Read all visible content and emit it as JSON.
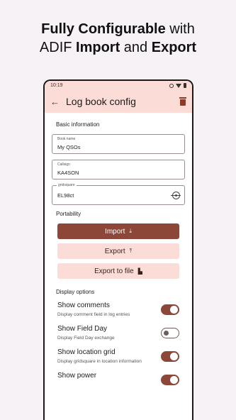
{
  "headline": {
    "line1_a": "Fully Configurable",
    "line1_b": " with",
    "line2_a": "ADIF ",
    "line2_b": "Import",
    "line2_c": " and ",
    "line2_d": "Export"
  },
  "statusbar": {
    "time": "10:19"
  },
  "appbar": {
    "title": "Log book config",
    "back_icon": "arrow-back-icon",
    "delete_icon": "trash-icon"
  },
  "basic": {
    "section_title": "Basic information",
    "book_name": {
      "label": "Book name",
      "value": "My QSOs"
    },
    "callsign": {
      "label": "Callsign",
      "value": "KA4SON"
    },
    "gridsquare": {
      "label": "gridsquare",
      "value": "EL98ct"
    }
  },
  "portability": {
    "section_title": "Portability",
    "import_label": "Import",
    "export_label": "Export",
    "export_file_label": "Export to file"
  },
  "display": {
    "section_title": "Display options",
    "options": [
      {
        "title": "Show comments",
        "desc": "Display comment field in log entries",
        "on": true
      },
      {
        "title": "Show Field Day",
        "desc": "Display Field Day exchange",
        "on": false
      },
      {
        "title": "Show location grid",
        "desc": "Display gridsquare in location information",
        "on": true
      },
      {
        "title": "Show power",
        "desc": "",
        "on": true
      }
    ]
  },
  "colors": {
    "accent": "#8c4739",
    "tonal": "#fbdcd6"
  }
}
